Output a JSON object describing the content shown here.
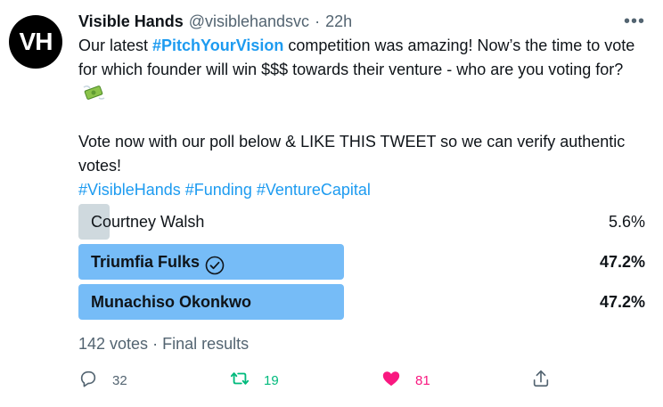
{
  "author": {
    "avatar_text": "VH",
    "name": "Visible Hands",
    "handle": "@visiblehandsvc",
    "separator": "·",
    "time": "22h"
  },
  "more_icon": "more-horizontal-icon",
  "text": {
    "line1_prefix": "Our latest ",
    "line1_hashtag": "#PitchYourVision",
    "line1_suffix": " competition was amazing! Now’s the time to vote for which founder will win $$$ towards their venture - who are you voting for?",
    "money_icon": "money-with-wings-emoji",
    "line2": "Vote now with our poll below & LIKE THIS TWEET so we can verify authentic votes!",
    "hashtags": [
      "#VisibleHands",
      "#Funding",
      "#VentureCapital"
    ]
  },
  "poll": {
    "options": [
      {
        "label": "Courtney Walsh",
        "percent_text": "5.6%",
        "percent": 5.6,
        "winner": false
      },
      {
        "label": "Triumfia Fulks",
        "percent_text": "47.2%",
        "percent": 47.2,
        "winner": true,
        "voted": true
      },
      {
        "label": "Munachiso Okonkwo",
        "percent_text": "47.2%",
        "percent": 47.2,
        "winner": true
      }
    ],
    "votes": "142 votes",
    "separator": "·",
    "status": "Final results"
  },
  "actions": {
    "replies": "32",
    "retweets": "19",
    "likes": "81"
  },
  "colors": {
    "link": "#1d9bf0",
    "retweet": "#00ba7c",
    "like": "#f91880",
    "winner_bar": "#76bcf7",
    "loser_bar": "#cfd9de",
    "muted": "#536471"
  }
}
